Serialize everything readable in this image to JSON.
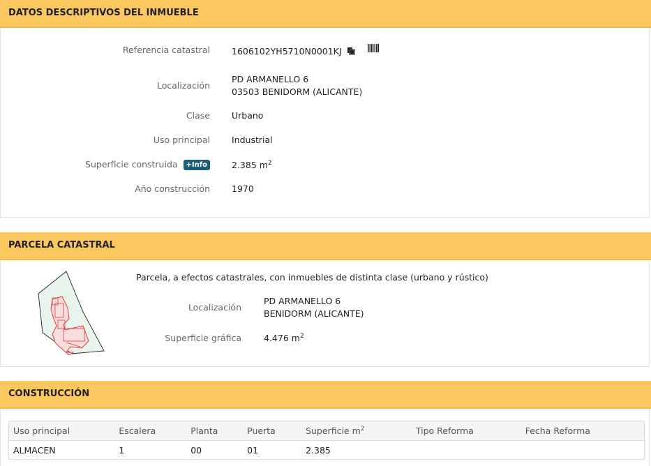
{
  "sections": {
    "datos": {
      "title": "DATOS DESCRIPTIVOS DEL INMUEBLE",
      "referencia_label": "Referencia catastral",
      "referencia_value": "1606102YH5710N0001KJ",
      "localizacion_label": "Localización",
      "localizacion_line1": "PD ARMANELLO 6",
      "localizacion_line2": "03503 BENIDORM (ALICANTE)",
      "clase_label": "Clase",
      "clase_value": "Urbano",
      "uso_label": "Uso principal",
      "uso_value": "Industrial",
      "superficie_label": "Superficie construida",
      "info_badge": "+Info",
      "superficie_value": "2.385 m",
      "superficie_unit_sup": "2",
      "anio_label": "Año construcción",
      "anio_value": "1970"
    },
    "parcela": {
      "title": "PARCELA CATASTRAL",
      "description": "Parcela, a efectos catastrales, con inmuebles de distinta clase (urbano y rústico)",
      "localizacion_label": "Localización",
      "localizacion_line1": "PD ARMANELLO 6",
      "localizacion_line2": "BENIDORM (ALICANTE)",
      "superficie_label": "Superficie gráfica",
      "superficie_value": "4.476 m",
      "superficie_unit_sup": "2"
    },
    "construccion": {
      "title": "CONSTRUCCIÓN",
      "columns": [
        "Uso principal",
        "Escalera",
        "Planta",
        "Puerta",
        "Superficie m",
        "Tipo Reforma",
        "Fecha Reforma"
      ],
      "superficie_col_sup": "2",
      "rows": [
        [
          "ALMACEN",
          "1",
          "00",
          "01",
          "2.385",
          "",
          ""
        ]
      ]
    }
  },
  "icons": {
    "copy": "copy-icon",
    "barcode": "barcode-icon"
  },
  "colors": {
    "header_bg": "#fbc75f",
    "info_badge_bg": "#1c5f7a",
    "parcel_outline": "#e23b3b",
    "parcel_fill": "#f6dede",
    "plot_fill": "#e9f5ec"
  }
}
